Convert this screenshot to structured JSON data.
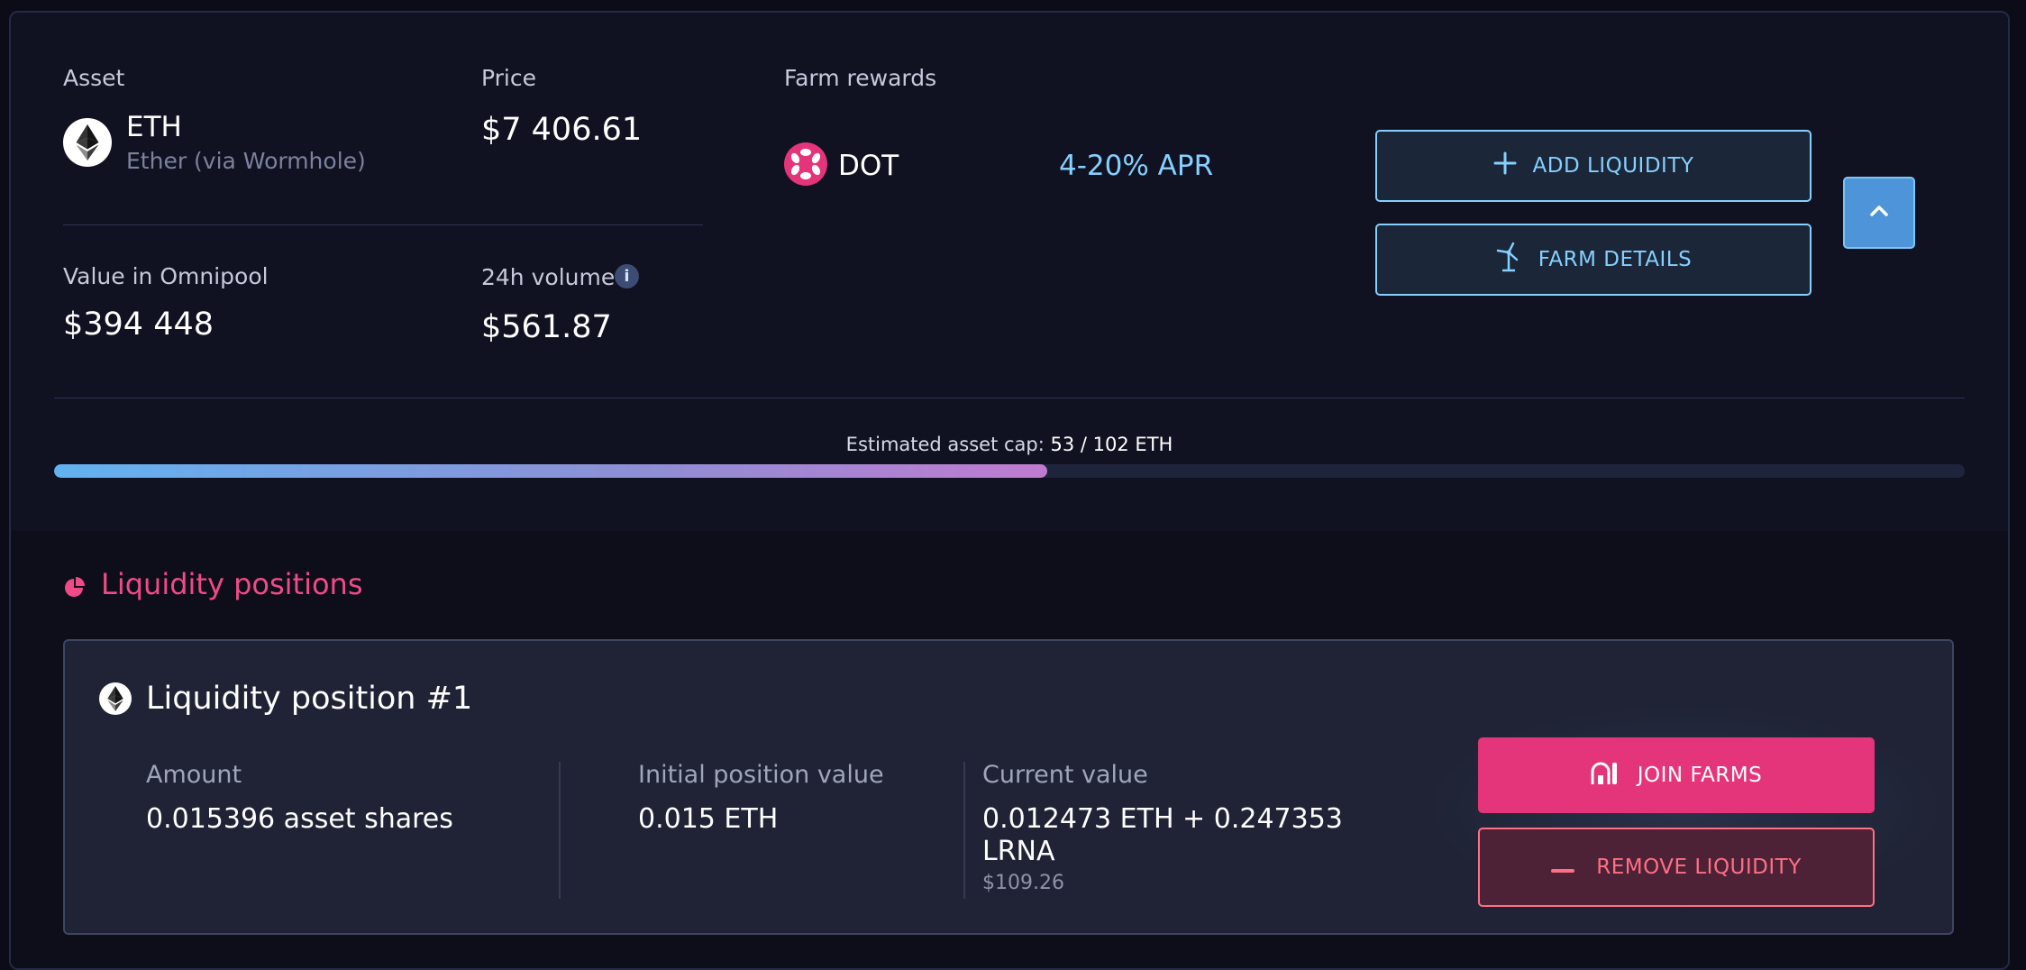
{
  "pool": {
    "asset_label": "Asset",
    "asset_symbol": "ETH",
    "asset_name": "Ether (via Wormhole)",
    "price_label": "Price",
    "price_value": "$7 406.61",
    "omnipool_label": "Value in Omnipool",
    "omnipool_value": "$394 448",
    "volume_label": "24h volume",
    "volume_value": "$561.87",
    "info_glyph": "i"
  },
  "farm": {
    "label": "Farm rewards",
    "symbol": "DOT",
    "apr": "4-20% APR"
  },
  "actions": {
    "add_liquidity": "ADD LIQUIDITY",
    "farm_details": "FARM DETAILS"
  },
  "cap": {
    "label": "Estimated asset cap:",
    "value": "53 / 102 ETH",
    "current": 53,
    "max": 102
  },
  "positions": {
    "section_title": "Liquidity positions",
    "items": [
      {
        "title": "Liquidity position #1",
        "amount_label": "Amount",
        "amount_value": "0.015396 asset shares",
        "initial_label": "Initial position value",
        "initial_value": "0.015 ETH",
        "current_label": "Current value",
        "current_value_line1": "0.012473 ETH + 0.247353",
        "current_value_line2": "LRNA",
        "current_usd": "$109.26",
        "join_farms": "JOIN FARMS",
        "remove_liquidity": "REMOVE LIQUIDITY"
      }
    ]
  },
  "colors": {
    "accent_blue": "#85d0ff",
    "accent_pink": "#e5357a",
    "danger": "#ff6f85",
    "background": "#111221"
  },
  "icons": [
    "eth-icon",
    "info-icon",
    "polkadot-icon",
    "plus-icon",
    "wind-turbine-icon",
    "chevron-up-icon",
    "pie-chart-icon",
    "farm-icon",
    "minus-icon"
  ]
}
